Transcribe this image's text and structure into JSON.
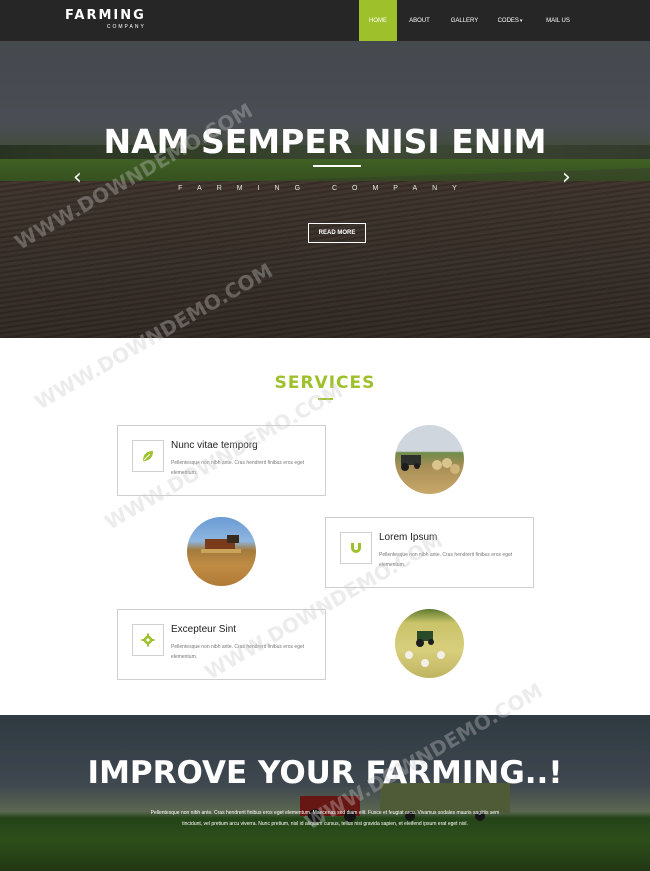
{
  "header": {
    "logo_main": "FARMING",
    "logo_sub": "COMPANY",
    "nav": [
      "HOME",
      "ABOUT",
      "GALLERY",
      "CODES",
      "MAIL US"
    ],
    "active": "HOME"
  },
  "hero": {
    "title": "NAM SEMPER NISI ENIM",
    "subtitle": "FARMING COMPANY",
    "button": "READ MORE",
    "prev_icon": "chevron-left-icon",
    "next_icon": "chevron-right-icon"
  },
  "services": {
    "title": "SERVICES",
    "cards": [
      {
        "title": "Nunc vitae temporg",
        "text": "Pellentesque non nibh ante. Cras hendrerit finibus eros eget elementum.",
        "icon": "leaf-icon"
      },
      {
        "title": "Lorem Ipsum",
        "text": "Pellentesque non nibh ante. Cras hendrerit finibus eros eget elementum.",
        "icon": "magnet-icon"
      },
      {
        "title": "Excepteur Sint",
        "text": "Pellentesque non nibh ante. Cras hendrerit finibus eros eget elementum.",
        "icon": "gear-icon"
      }
    ]
  },
  "improve": {
    "title": "IMPROVE YOUR FARMING..!",
    "text": "Pellentesque non nibh ante. Cras hendrerit finibus eros eget elementum. Maecenas sed diam elit. Fusce et feugiat arcu. Vivamus sodales mauris sagittis sem tincidunt, vel pretium arcu viverra. Nunc pretium, nisl id aliquam cursus, tellus nisi gravida sapien, et eleifend ipsum erat eget nisl."
  },
  "colors": {
    "accent": "#9ec12b",
    "header_bg": "#262626"
  },
  "watermark": "WWW.DOWNDEMO.COM"
}
